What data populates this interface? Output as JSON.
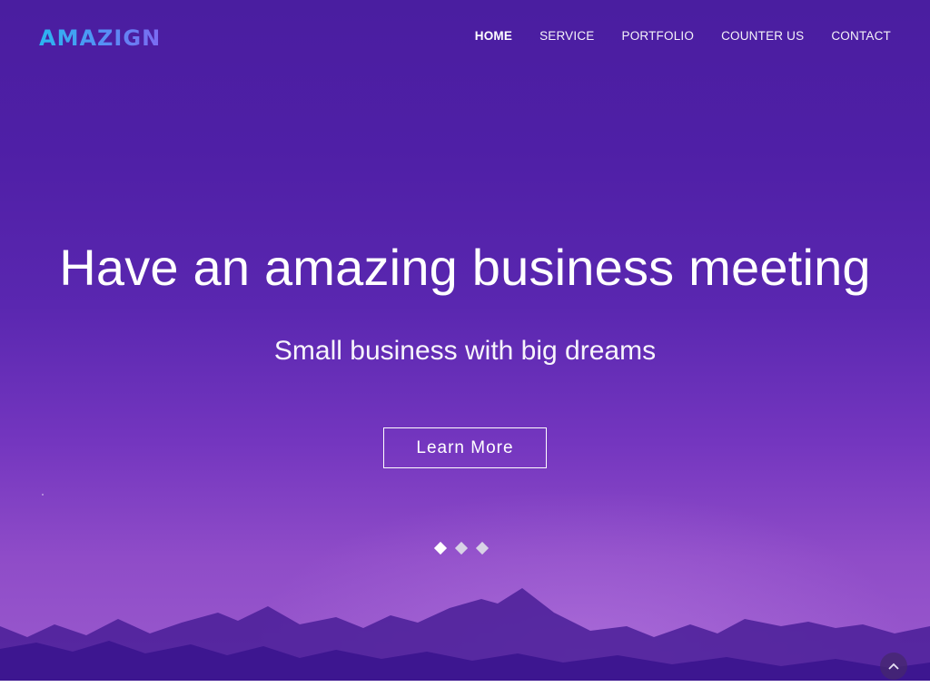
{
  "brand": {
    "logo_text": "AMAZIGN"
  },
  "nav": {
    "items": [
      {
        "label": "HOME",
        "active": true
      },
      {
        "label": "SERVICE",
        "active": false
      },
      {
        "label": "PORTFOLIO",
        "active": false
      },
      {
        "label": "COUNTER US",
        "active": false
      },
      {
        "label": "CONTACT",
        "active": false
      }
    ]
  },
  "hero": {
    "headline": "Have an amazing business meeting",
    "subheadline": "Small business with big dreams",
    "cta_label": "Learn More",
    "slides_total": 3,
    "active_slide": 1
  },
  "icons": {
    "scroll_top": "chevron-up-icon",
    "slider_dot": "diamond-icon"
  },
  "colors": {
    "gradient_top": "#4a1ea0",
    "gradient_bottom": "#9a5acd",
    "mountains": "#3d1690",
    "logo_start": "#2ab6f0",
    "logo_end": "#8a5cf0",
    "text": "#ffffff"
  }
}
